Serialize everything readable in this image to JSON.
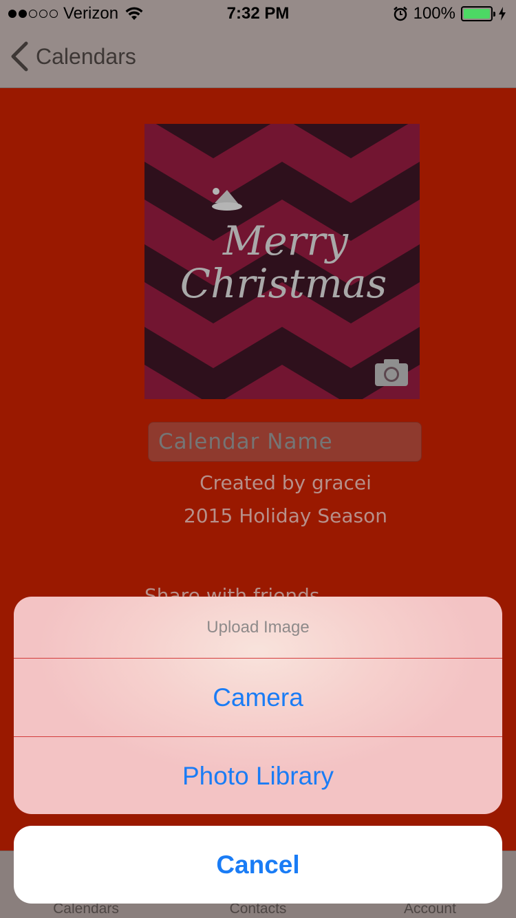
{
  "status_bar": {
    "carrier": "Verizon",
    "time": "7:32 PM",
    "battery": "100%",
    "signal_bars_filled": 2,
    "signal_bars_total": 5
  },
  "nav": {
    "back_label": "Calendars"
  },
  "cover": {
    "line1": "Merry",
    "line2": "Christmas"
  },
  "form": {
    "name_placeholder": "Calendar Name",
    "created_by": "Created by gracei",
    "season": "2015 Holiday Season",
    "share_label": "Share with friends"
  },
  "tabs": [
    {
      "label": "Calendars"
    },
    {
      "label": "Contacts"
    },
    {
      "label": "Account"
    }
  ],
  "action_sheet": {
    "title": "Upload Image",
    "options": [
      {
        "label": "Camera"
      },
      {
        "label": "Photo Library"
      }
    ],
    "cancel_label": "Cancel"
  },
  "colors": {
    "background": "#9a1900",
    "bar": "#968b89",
    "action_blue": "#1a7cf5"
  }
}
